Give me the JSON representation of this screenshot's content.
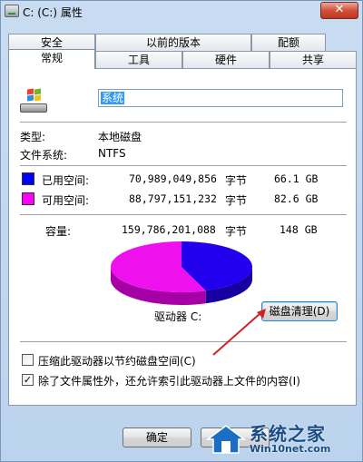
{
  "window": {
    "title": "C: (C:) 属性",
    "close": "✕"
  },
  "tabs_back": [
    "安全",
    "以前的版本",
    "配额"
  ],
  "tabs_front": [
    "常规",
    "工具",
    "硬件",
    "共享"
  ],
  "general": {
    "name_value": "系统",
    "type_label": "类型:",
    "type_value": "本地磁盘",
    "fs_label": "文件系统:",
    "fs_value": "NTFS",
    "used_label": "已用空间:",
    "used_bytes": "70,989,049,856",
    "used_unit": "字节",
    "used_size": "66.1 GB",
    "free_label": "可用空间:",
    "free_bytes": "88,797,151,232",
    "free_unit": "字节",
    "free_size": "82.6 GB",
    "capacity_label": "容量:",
    "capacity_bytes": "159,786,201,088",
    "capacity_unit": "字节",
    "capacity_size": "148 GB",
    "drive_label": "驱动器 C:",
    "cleanup_button": "磁盘清理(D)",
    "compress_label": "压缩此驱动器以节约磁盘空间(C)",
    "compress_checked": false,
    "index_label": "除了文件属性外，还允许索引此驱动器上文件的内容(I)",
    "index_checked": true,
    "check_mark": "✓"
  },
  "pie": {
    "used_fraction": 0.444,
    "used_color": "#2200ee",
    "free_color": "#ee11ee"
  },
  "colors": {
    "used": "#0000ff",
    "free": "#ff00ff",
    "arrow": "#d32020"
  },
  "footer": {
    "ok_button": "确定"
  },
  "watermark": {
    "title": "系统之家",
    "subtitle": "Win10net.com"
  }
}
